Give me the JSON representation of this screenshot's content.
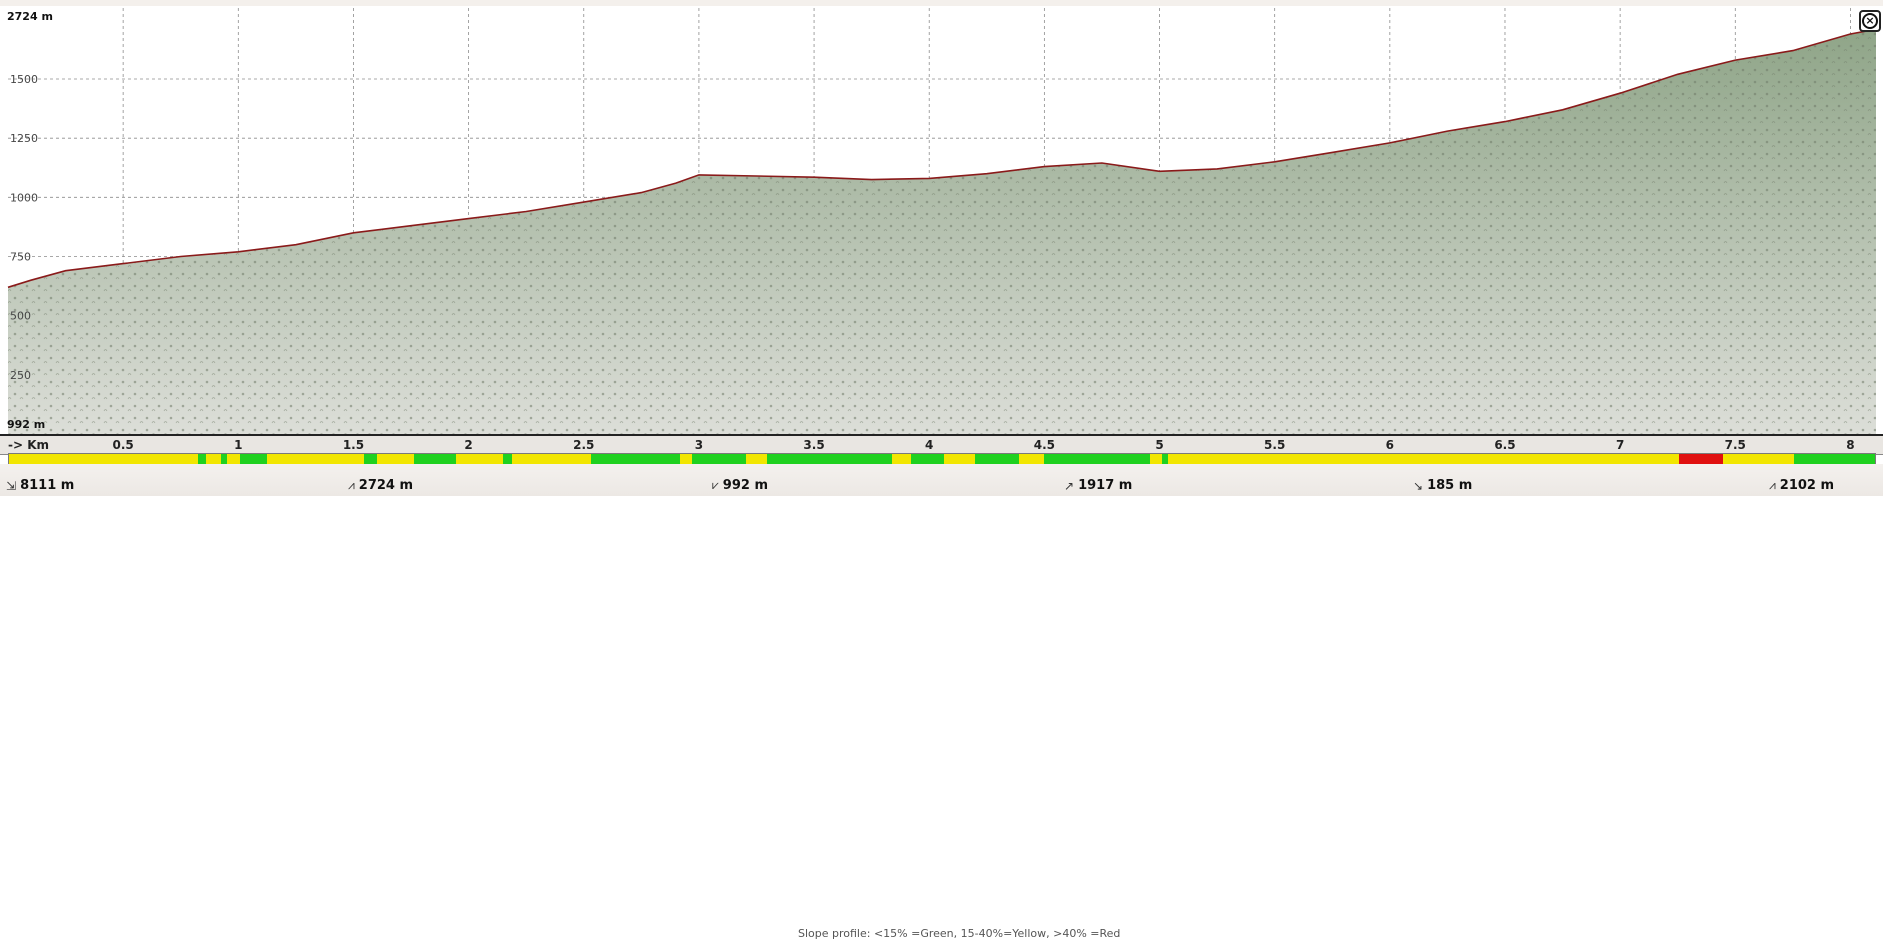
{
  "chart_data": {
    "type": "area",
    "title": "",
    "xlabel": "-> Km",
    "ylabel": "",
    "xlim": [
      0,
      8.111
    ],
    "ylim": [
      0,
      1800
    ],
    "grid": true,
    "x_ticks": [
      "0.5",
      "1",
      "1.5",
      "2",
      "2.5",
      "3",
      "3.5",
      "4",
      "4.5",
      "5",
      "5.5",
      "6",
      "6.5",
      "7",
      "7.5",
      "8"
    ],
    "y_ticks": [
      "1500",
      "1250",
      "1000",
      "750",
      "500",
      "250"
    ],
    "max_label": "2724 m",
    "min_label": "992 m",
    "x": [
      0,
      0.1,
      0.25,
      0.5,
      0.75,
      1,
      1.25,
      1.5,
      1.75,
      2,
      2.25,
      2.5,
      2.75,
      2.9,
      3.0,
      3.25,
      3.5,
      3.75,
      4.0,
      4.25,
      4.5,
      4.75,
      5.0,
      5.25,
      5.5,
      5.75,
      6.0,
      6.25,
      6.5,
      6.75,
      7.0,
      7.25,
      7.5,
      7.75,
      8.0,
      8.111
    ],
    "series": [
      {
        "values": [
          620,
          650,
          690,
          720,
          750,
          770,
          800,
          850,
          880,
          910,
          940,
          980,
          1020,
          1060,
          1095,
          1090,
          1085,
          1075,
          1080,
          1100,
          1130,
          1145,
          1110,
          1120,
          1150,
          1190,
          1230,
          1280,
          1320,
          1370,
          1440,
          1520,
          1580,
          1620,
          1690,
          1710
        ]
      }
    ]
  },
  "axis": {
    "km_label": "-> Km"
  },
  "slope_legend": "Slope profile: <15% =Green, 15-40%=Yellow, >40% =Red",
  "slope_colors": {
    "green": "#1fd11f",
    "yellow": "#f2e600",
    "red": "#e01010"
  },
  "slope_segments": [
    [
      "yellow",
      9.1
    ],
    [
      "green",
      0.4
    ],
    [
      "yellow",
      0.7
    ],
    [
      "green",
      0.3
    ],
    [
      "yellow",
      0.6
    ],
    [
      "green",
      1.3
    ],
    [
      "yellow",
      4.7
    ],
    [
      "green",
      0.6
    ],
    [
      "yellow",
      1.8
    ],
    [
      "green",
      2.0
    ],
    [
      "yellow",
      2.3
    ],
    [
      "green",
      0.4
    ],
    [
      "yellow",
      3.8
    ],
    [
      "green",
      4.3
    ],
    [
      "yellow",
      0.6
    ],
    [
      "green",
      2.6
    ],
    [
      "yellow",
      1.0
    ],
    [
      "green",
      6.0
    ],
    [
      "yellow",
      0.9
    ],
    [
      "green",
      1.6
    ],
    [
      "yellow",
      1.5
    ],
    [
      "green",
      2.1
    ],
    [
      "yellow",
      1.2
    ],
    [
      "green",
      5.1
    ],
    [
      "yellow",
      0.6
    ],
    [
      "green",
      0.3
    ],
    [
      "yellow",
      10.4
    ],
    [
      "yellow",
      9.5
    ],
    [
      "yellow",
      4.7
    ],
    [
      "red",
      2.1
    ],
    [
      "yellow",
      3.4
    ],
    [
      "green",
      3.9
    ]
  ],
  "stats": [
    {
      "icon": "distance-icon",
      "glyph": "⇲",
      "value": "8111 m"
    },
    {
      "icon": "max-altitude-icon",
      "glyph": "⩘",
      "value": "2724 m"
    },
    {
      "icon": "min-altitude-icon",
      "glyph": "⩗",
      "value": "992 m"
    },
    {
      "icon": "ascent-icon",
      "glyph": "↗",
      "value": "1917 m"
    },
    {
      "icon": "descent-icon",
      "glyph": "↘",
      "value": "185 m"
    },
    {
      "icon": "end-altitude-icon",
      "glyph": "⩘",
      "value": "2102 m"
    }
  ],
  "colors": {
    "terrain_fill": "#a9b8a0",
    "terrain_outline": "#8a1a1a",
    "grid": "#8c8c8c",
    "border": "#cc2a2a"
  }
}
